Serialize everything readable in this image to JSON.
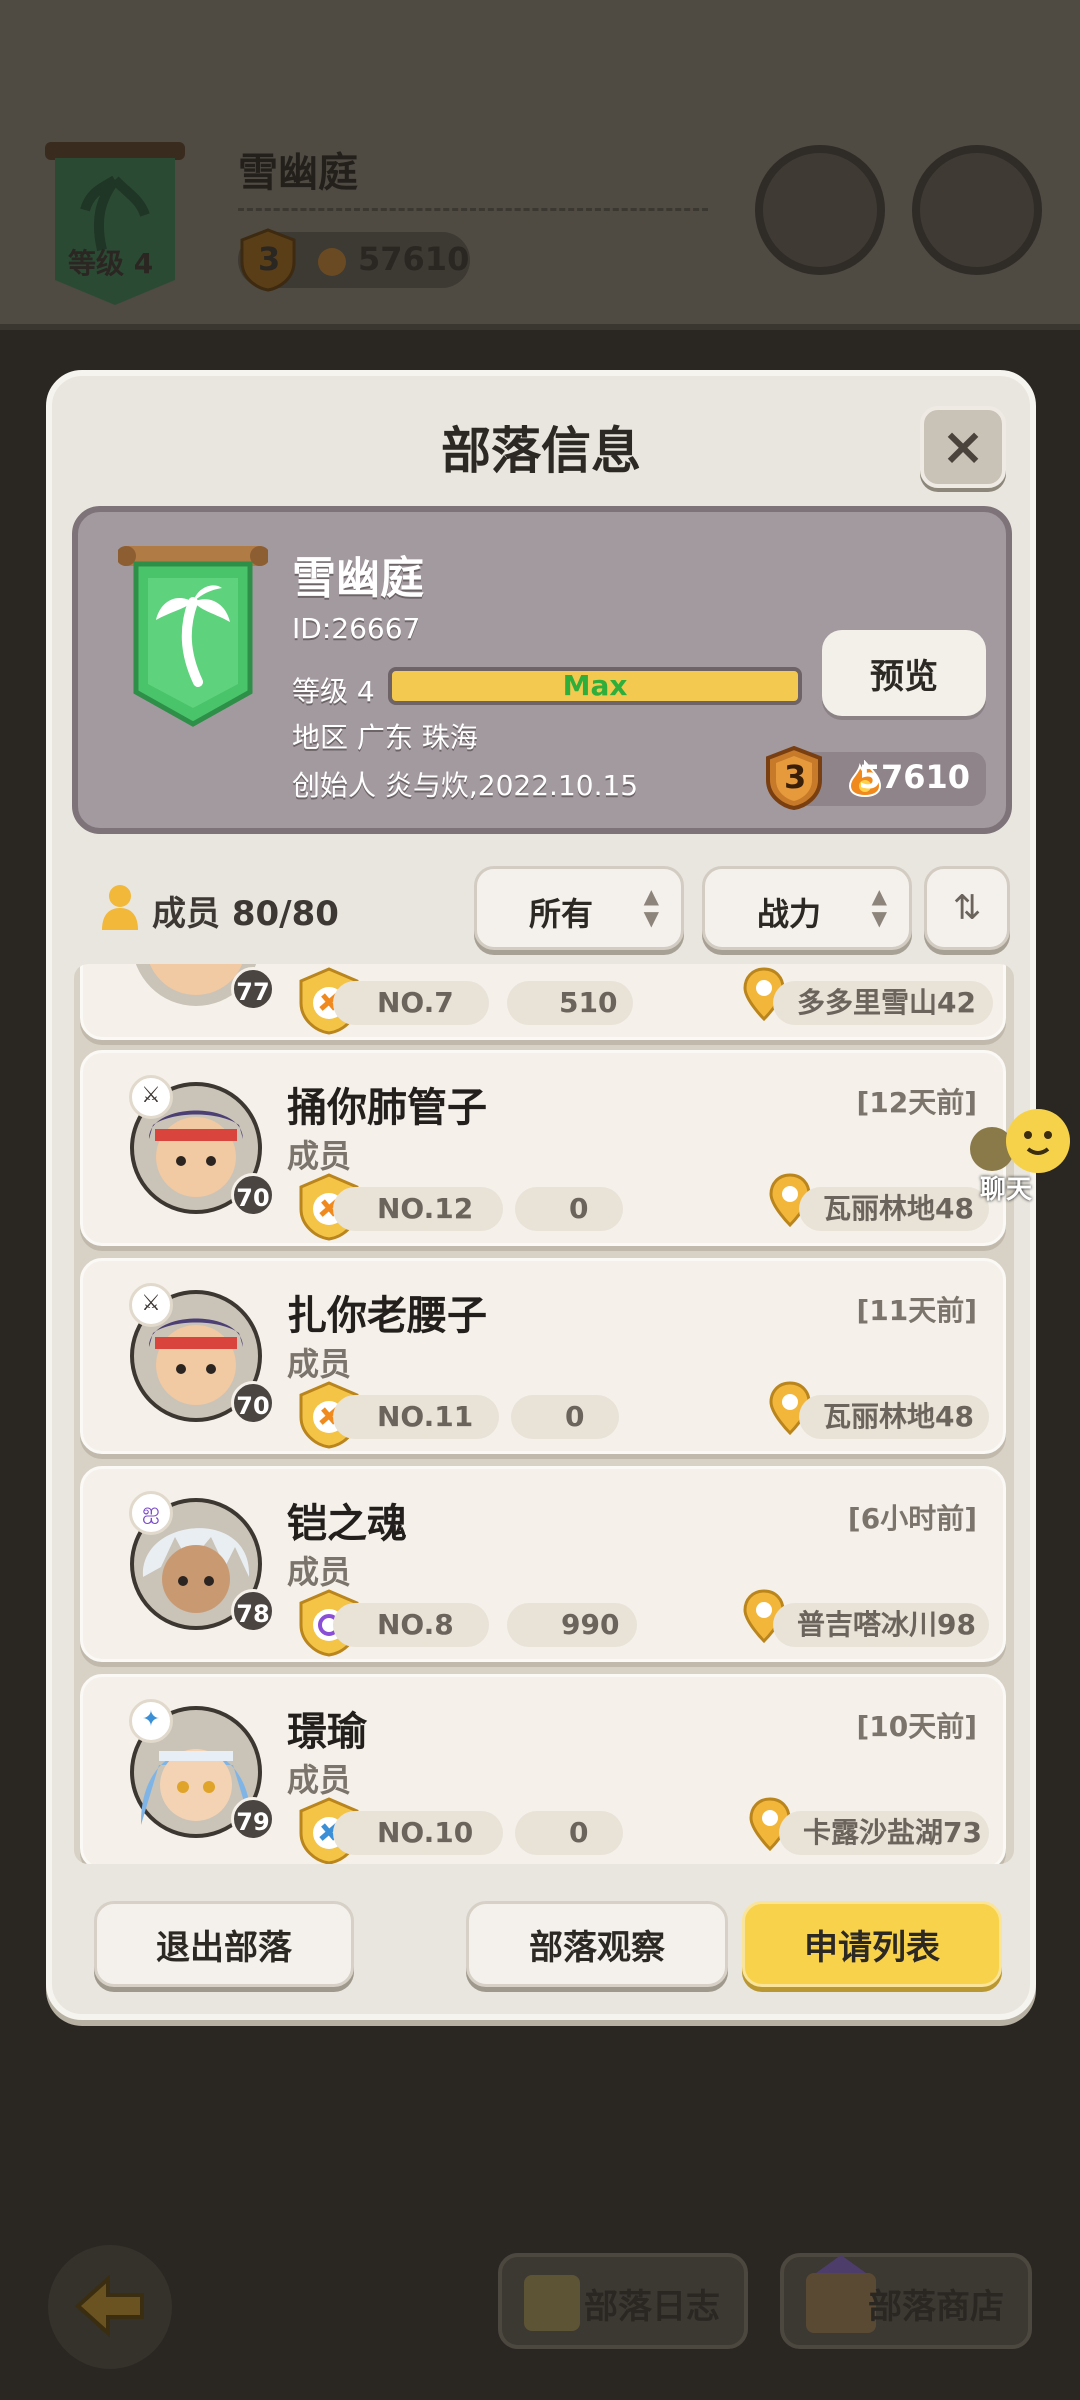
{
  "background": {
    "tribe_name": "雪幽庭",
    "banner_level": "等级 4",
    "rank": "3",
    "power": "57610"
  },
  "modal": {
    "title": "部落信息",
    "close": "×"
  },
  "tribe": {
    "name": "雪幽庭",
    "id": "ID:26667",
    "level_label": "等级 4",
    "level_status": "Max",
    "region": "地区 广东 珠海",
    "founder": "创始人 炎与炊,2022.10.15",
    "rank": "3",
    "power": "57610",
    "preview_label": "预览"
  },
  "filter": {
    "members": "成员 80/80",
    "scope": "所有",
    "sort_by": "战力",
    "sort_icon": "⇅"
  },
  "members": [
    {
      "name": "",
      "role": "",
      "time": "",
      "level": "77",
      "rank": "NO.7",
      "contribution": "510",
      "location": "多多里雪山42"
    },
    {
      "name": "捅你肺管子",
      "role": "成员",
      "time": "[12天前]",
      "level": "70",
      "rank": "NO.12",
      "contribution": "0",
      "location": "瓦丽林地48"
    },
    {
      "name": "扎你老腰子",
      "role": "成员",
      "time": "[11天前]",
      "level": "70",
      "rank": "NO.11",
      "contribution": "0",
      "location": "瓦丽林地48"
    },
    {
      "name": "铠之魂",
      "role": "成员",
      "time": "[6小时前]",
      "level": "78",
      "rank": "NO.8",
      "contribution": "990",
      "location": "普吉嗒冰川98"
    },
    {
      "name": "璟瑜",
      "role": "成员",
      "time": "[10天前]",
      "level": "79",
      "rank": "NO.10",
      "contribution": "0",
      "location": "卡露沙盐湖73"
    }
  ],
  "footer": {
    "leave": "退出部落",
    "observe": "部落观察",
    "applications": "申请列表"
  },
  "chat": {
    "label": "聊天"
  },
  "bottom_nav": {
    "log": "部落日志",
    "shop": "部落商店"
  },
  "colors": {
    "accent_yellow": "#f7d24a",
    "banner_green": "#3cbb5b",
    "max_green": "#2fae3b"
  }
}
